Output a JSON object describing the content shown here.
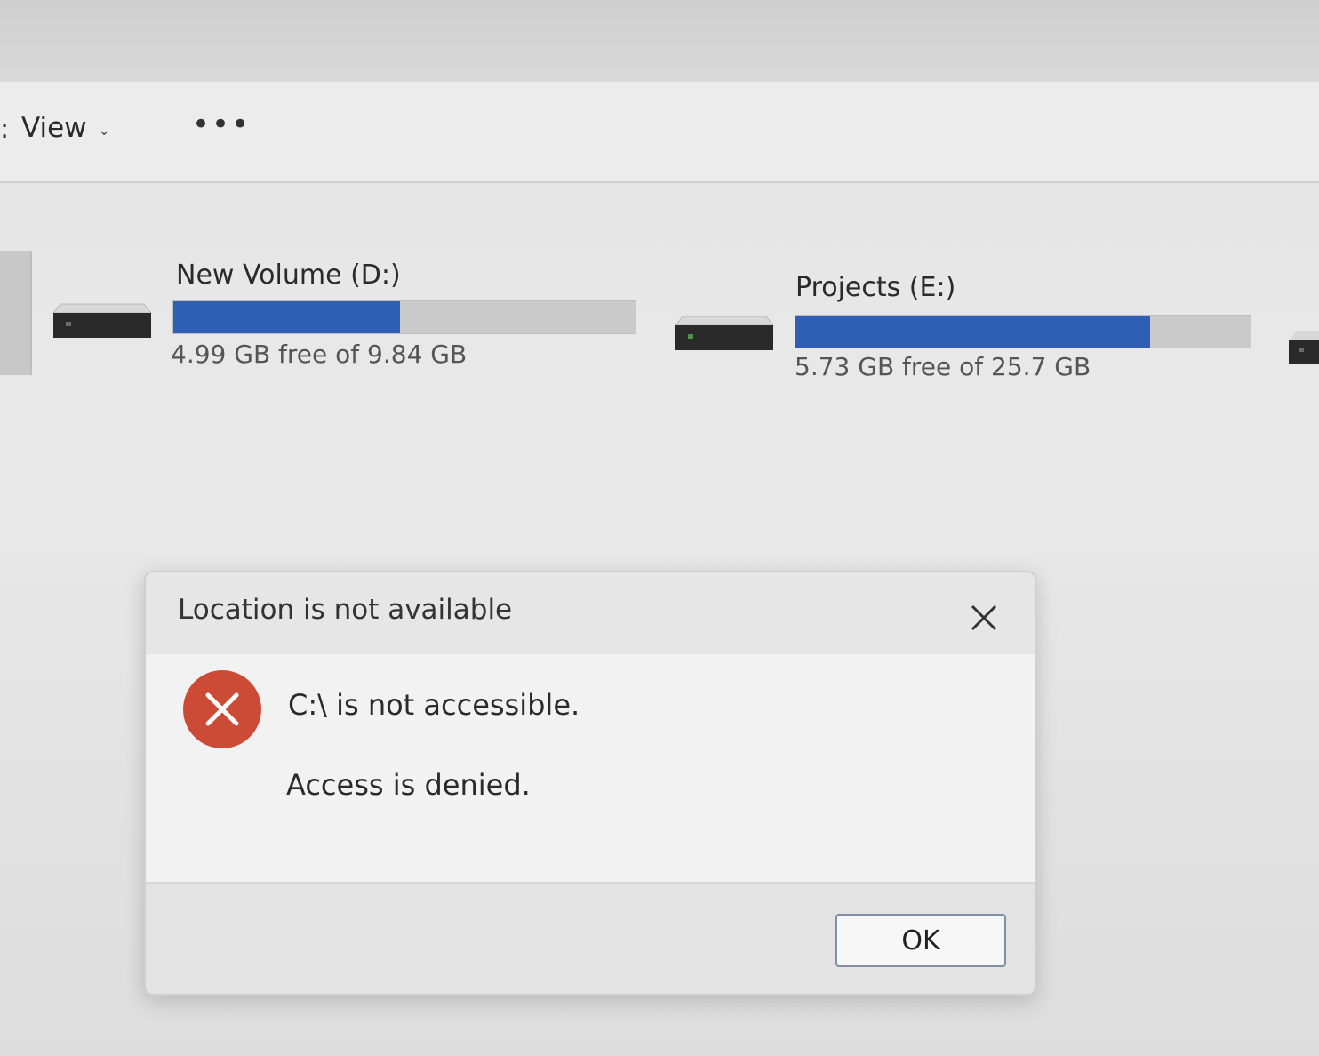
{
  "toolbar": {
    "view_label": "View",
    "more_label": "•••"
  },
  "drives": [
    {
      "title": "New Volume (D:)",
      "free_text": "4.99 GB free of 9.84 GB",
      "used_fraction": 0.49
    },
    {
      "title": "Projects (E:)",
      "free_text": "5.73 GB free of 25.7 GB",
      "used_fraction": 0.78
    }
  ],
  "dialog": {
    "title": "Location is not available",
    "message": "C:\\ is not accessible.",
    "detail": "Access is denied.",
    "ok_label": "OK"
  },
  "colors": {
    "usage_bar": "#2f5fb4",
    "error_icon": "#cc4b37"
  }
}
